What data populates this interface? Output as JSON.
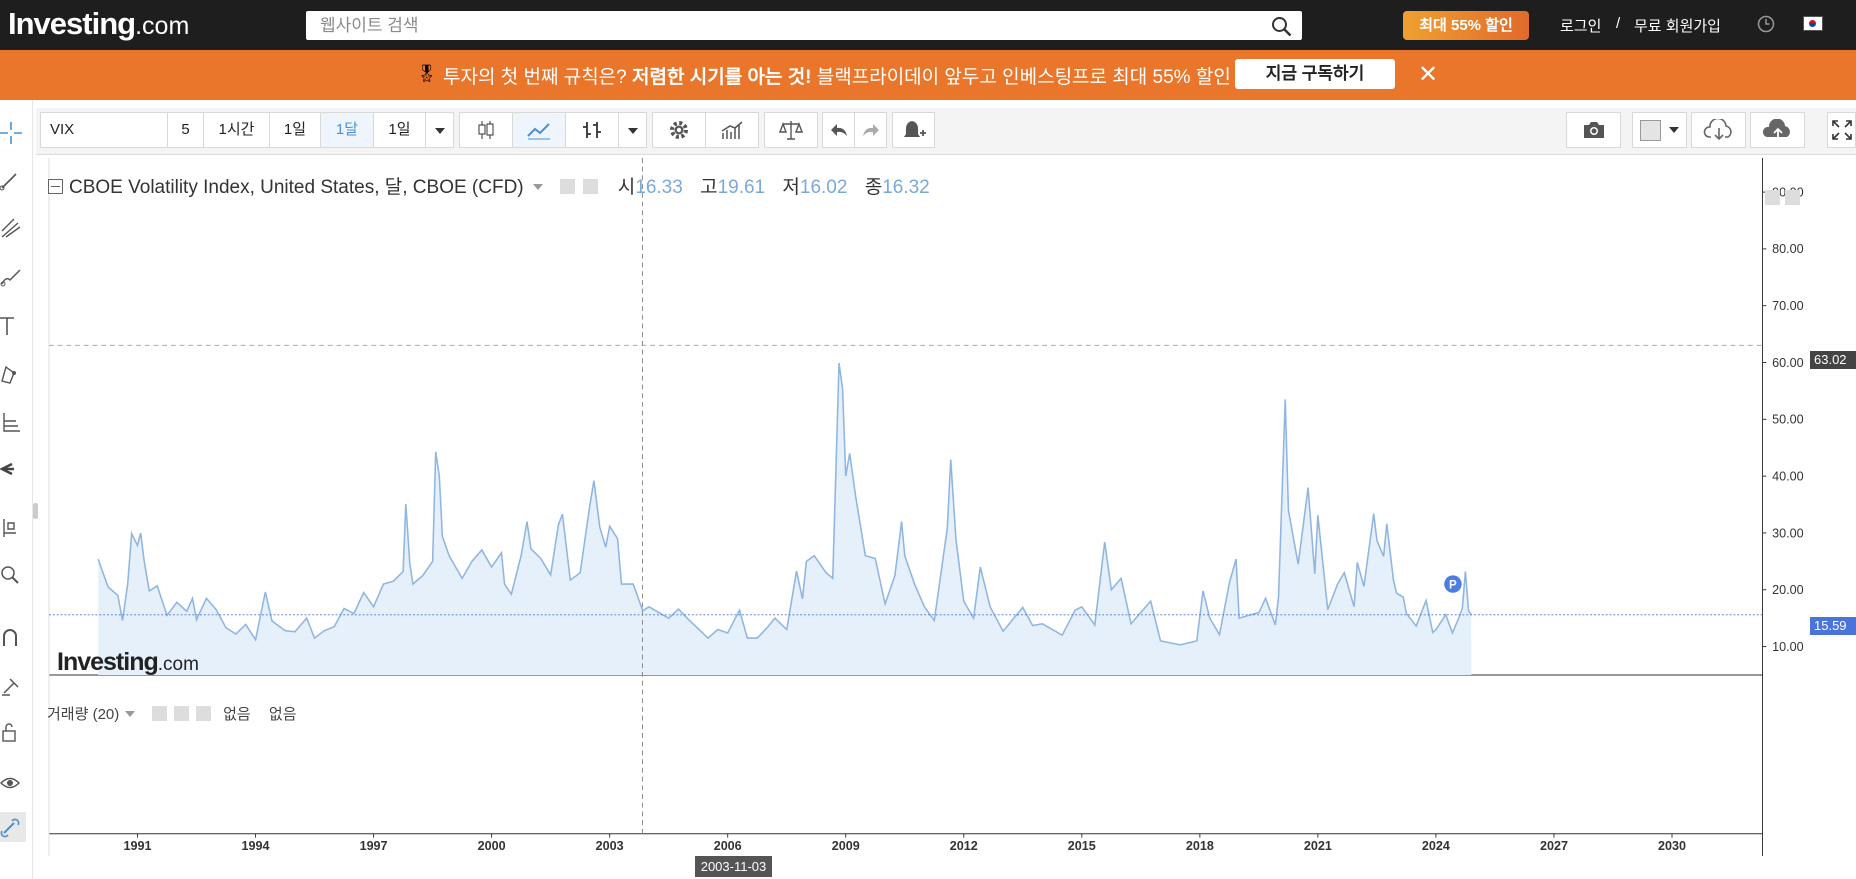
{
  "header": {
    "logo_main": "Investing",
    "logo_suffix": ".com",
    "search_placeholder": "웹사이트 검색",
    "promo_button": "최대 55% 할인",
    "login": "로그인",
    "separator": "/",
    "signup": "무료 회원가입",
    "icons": [
      "search-icon",
      "clock-icon",
      "korea-flag-icon"
    ]
  },
  "banner": {
    "icon": "medal-icon",
    "text_1": "투자의 첫 번째 규칙은? ",
    "text_bold": "저렴한 시기를 아는 것!",
    "text_2": " 블랙프라이데이 앞두고 인베스팅프로 최대 55% 할인",
    "cta": "지금 구독하기",
    "close": "✕"
  },
  "toolbar": {
    "symbol": "VIX",
    "intervals": [
      "5",
      "1시간",
      "1일",
      "1달",
      "1일"
    ],
    "selected_interval": "1달",
    "icons": [
      "interval-dropdown-icon",
      "candlestick-icon",
      "line-chart-icon",
      "bar-chart-icon",
      "chart-type-dropdown-icon",
      "settings-icon",
      "indicators-icon",
      "compare-icon",
      "undo-icon",
      "redo-icon",
      "alert-icon",
      "camera-icon",
      "color-swatch-icon",
      "swatch-dropdown-icon",
      "cloud-download-icon",
      "cloud-upload-icon",
      "fullscreen-icon"
    ]
  },
  "left_tools": [
    "crosshair-icon",
    "trend-line-icon",
    "pitchfork-icon",
    "brush-icon",
    "text-icon",
    "pattern-icon",
    "measure-icon",
    "pin-icon",
    "long-position-icon",
    "zoom-icon",
    "magnet-icon",
    "lock-drawing-icon",
    "lock-icon",
    "eye-icon",
    "link-icon"
  ],
  "legend": {
    "title": "CBOE Volatility Index, United States, 달, CBOE (CFD)",
    "open_label": "시",
    "open": "16.33",
    "high_label": "고",
    "high": "19.61",
    "low_label": "저",
    "low": "16.02",
    "close_label": "종",
    "close": "16.32"
  },
  "volume_legend": {
    "label": "거래량 (20)",
    "value1": "없음",
    "value2": "없음"
  },
  "crosshair": {
    "date": "2003-11-03",
    "price": "63.02"
  },
  "last_price": "15.59",
  "marker": "P",
  "watermark_main": "Investing",
  "watermark_suffix": ".com",
  "colors": {
    "line": "#8fb5e2",
    "fill": "#e6f0fa",
    "last_price": "#4a74d9",
    "banner": "#e9762b",
    "topbar": "#1e1e1e"
  },
  "chart_data": {
    "type": "area",
    "title": "CBOE Volatility Index, United States, 달, CBOE (CFD)",
    "xlabel": "",
    "ylabel": "",
    "ylim": [
      5,
      96
    ],
    "grid": false,
    "y_ticks": [
      "90.00",
      "80.00",
      "70.00",
      "60.00",
      "50.00",
      "40.00",
      "30.00",
      "20.00",
      "10.00"
    ],
    "x_ticks": [
      "1991",
      "1994",
      "1997",
      "2000",
      "2003",
      "2006",
      "2009",
      "2012",
      "2015",
      "2018",
      "2021",
      "2024",
      "2027",
      "2030"
    ],
    "x_range": [
      1988.75,
      2032.3
    ],
    "series": [
      {
        "values": [
          [
            1990.0,
            25.4
          ],
          [
            1990.25,
            20.5
          ],
          [
            1990.5,
            19.0
          ],
          [
            1990.62,
            14.6
          ],
          [
            1990.75,
            21.0
          ],
          [
            1990.85,
            29.9
          ],
          [
            1991.0,
            27.8
          ],
          [
            1991.08,
            30.0
          ],
          [
            1991.17,
            25.0
          ],
          [
            1991.3,
            19.8
          ],
          [
            1991.5,
            20.7
          ],
          [
            1991.75,
            15.5
          ],
          [
            1992.0,
            17.8
          ],
          [
            1992.25,
            16.2
          ],
          [
            1992.4,
            18.5
          ],
          [
            1992.5,
            14.7
          ],
          [
            1992.75,
            18.5
          ],
          [
            1993.0,
            16.5
          ],
          [
            1993.25,
            13.3
          ],
          [
            1993.5,
            12.2
          ],
          [
            1993.75,
            13.9
          ],
          [
            1994.0,
            11.2
          ],
          [
            1994.25,
            19.6
          ],
          [
            1994.42,
            14.5
          ],
          [
            1994.75,
            12.8
          ],
          [
            1995.0,
            12.6
          ],
          [
            1995.3,
            15.0
          ],
          [
            1995.5,
            11.5
          ],
          [
            1995.75,
            12.8
          ],
          [
            1996.0,
            13.5
          ],
          [
            1996.25,
            16.7
          ],
          [
            1996.5,
            15.8
          ],
          [
            1996.75,
            19.5
          ],
          [
            1997.0,
            17.0
          ],
          [
            1997.25,
            21.0
          ],
          [
            1997.5,
            21.5
          ],
          [
            1997.75,
            23.2
          ],
          [
            1997.82,
            35.1
          ],
          [
            1997.92,
            24.7
          ],
          [
            1998.0,
            21.0
          ],
          [
            1998.25,
            22.5
          ],
          [
            1998.5,
            25.0
          ],
          [
            1998.58,
            44.3
          ],
          [
            1998.67,
            40.0
          ],
          [
            1998.75,
            29.4
          ],
          [
            1998.92,
            26.0
          ],
          [
            1999.25,
            22.0
          ],
          [
            1999.5,
            25.0
          ],
          [
            1999.75,
            27.0
          ],
          [
            2000.0,
            24.0
          ],
          [
            2000.25,
            26.5
          ],
          [
            2000.33,
            21.0
          ],
          [
            2000.5,
            19.2
          ],
          [
            2000.75,
            26.0
          ],
          [
            2000.9,
            32.0
          ],
          [
            2001.0,
            27.2
          ],
          [
            2001.25,
            25.5
          ],
          [
            2001.5,
            22.6
          ],
          [
            2001.7,
            31.5
          ],
          [
            2001.8,
            33.3
          ],
          [
            2002.0,
            21.7
          ],
          [
            2002.25,
            23.0
          ],
          [
            2002.5,
            35.0
          ],
          [
            2002.6,
            39.2
          ],
          [
            2002.75,
            31.0
          ],
          [
            2002.9,
            27.5
          ],
          [
            2003.0,
            31.2
          ],
          [
            2003.2,
            29.0
          ],
          [
            2003.3,
            21.0
          ],
          [
            2003.6,
            21.0
          ],
          [
            2003.84,
            16.3
          ],
          [
            2004.0,
            17.0
          ],
          [
            2004.25,
            16.0
          ],
          [
            2004.5,
            15.0
          ],
          [
            2004.75,
            16.6
          ],
          [
            2005.0,
            14.8
          ],
          [
            2005.5,
            11.5
          ],
          [
            2005.75,
            13.0
          ],
          [
            2006.0,
            12.4
          ],
          [
            2006.3,
            16.4
          ],
          [
            2006.5,
            11.5
          ],
          [
            2006.75,
            11.5
          ],
          [
            2007.0,
            13.3
          ],
          [
            2007.2,
            15.0
          ],
          [
            2007.5,
            13.0
          ],
          [
            2007.75,
            23.3
          ],
          [
            2007.9,
            18.4
          ],
          [
            2008.0,
            25.0
          ],
          [
            2008.2,
            26.0
          ],
          [
            2008.5,
            23.0
          ],
          [
            2008.67,
            22.0
          ],
          [
            2008.83,
            59.9
          ],
          [
            2008.92,
            55.3
          ],
          [
            2009.0,
            40.0
          ],
          [
            2009.1,
            44.0
          ],
          [
            2009.25,
            36.5
          ],
          [
            2009.5,
            26.0
          ],
          [
            2009.75,
            25.5
          ],
          [
            2010.0,
            17.5
          ],
          [
            2010.25,
            22.5
          ],
          [
            2010.42,
            32.0
          ],
          [
            2010.5,
            26.0
          ],
          [
            2010.75,
            21.0
          ],
          [
            2011.0,
            17.0
          ],
          [
            2011.25,
            14.6
          ],
          [
            2011.58,
            30.8
          ],
          [
            2011.67,
            42.9
          ],
          [
            2011.8,
            29.0
          ],
          [
            2012.0,
            18.0
          ],
          [
            2012.25,
            15.0
          ],
          [
            2012.42,
            24.0
          ],
          [
            2012.67,
            17.0
          ],
          [
            2013.0,
            12.7
          ],
          [
            2013.5,
            16.9
          ],
          [
            2013.75,
            13.7
          ],
          [
            2014.0,
            14.0
          ],
          [
            2014.5,
            12.0
          ],
          [
            2014.83,
            16.4
          ],
          [
            2015.0,
            17.0
          ],
          [
            2015.33,
            13.8
          ],
          [
            2015.58,
            28.4
          ],
          [
            2015.75,
            20.0
          ],
          [
            2016.0,
            22.0
          ],
          [
            2016.25,
            14.0
          ],
          [
            2016.5,
            16.0
          ],
          [
            2016.75,
            18.0
          ],
          [
            2017.0,
            11.0
          ],
          [
            2017.5,
            10.3
          ],
          [
            2017.92,
            11.0
          ],
          [
            2018.08,
            19.8
          ],
          [
            2018.25,
            15.0
          ],
          [
            2018.5,
            12.1
          ],
          [
            2018.75,
            21.2
          ],
          [
            2018.92,
            25.4
          ],
          [
            2019.0,
            15.0
          ],
          [
            2019.5,
            16.0
          ],
          [
            2019.67,
            18.5
          ],
          [
            2019.92,
            13.8
          ],
          [
            2020.0,
            18.8
          ],
          [
            2020.17,
            53.5
          ],
          [
            2020.25,
            34.0
          ],
          [
            2020.5,
            24.5
          ],
          [
            2020.75,
            38.0
          ],
          [
            2020.92,
            22.8
          ],
          [
            2021.0,
            33.1
          ],
          [
            2021.25,
            16.5
          ],
          [
            2021.5,
            21.0
          ],
          [
            2021.67,
            23.0
          ],
          [
            2021.92,
            17.0
          ],
          [
            2022.0,
            24.8
          ],
          [
            2022.17,
            20.6
          ],
          [
            2022.42,
            33.4
          ],
          [
            2022.5,
            28.7
          ],
          [
            2022.67,
            25.9
          ],
          [
            2022.75,
            31.6
          ],
          [
            2022.92,
            21.7
          ],
          [
            2023.0,
            19.4
          ],
          [
            2023.17,
            18.7
          ],
          [
            2023.25,
            15.8
          ],
          [
            2023.5,
            13.6
          ],
          [
            2023.75,
            18.1
          ],
          [
            2023.92,
            12.5
          ],
          [
            2024.0,
            13.0
          ],
          [
            2024.25,
            15.6
          ],
          [
            2024.42,
            12.4
          ],
          [
            2024.58,
            15.0
          ],
          [
            2024.67,
            16.7
          ],
          [
            2024.75,
            23.2
          ],
          [
            2024.83,
            16.3
          ],
          [
            2024.9,
            15.59
          ]
        ]
      }
    ]
  }
}
